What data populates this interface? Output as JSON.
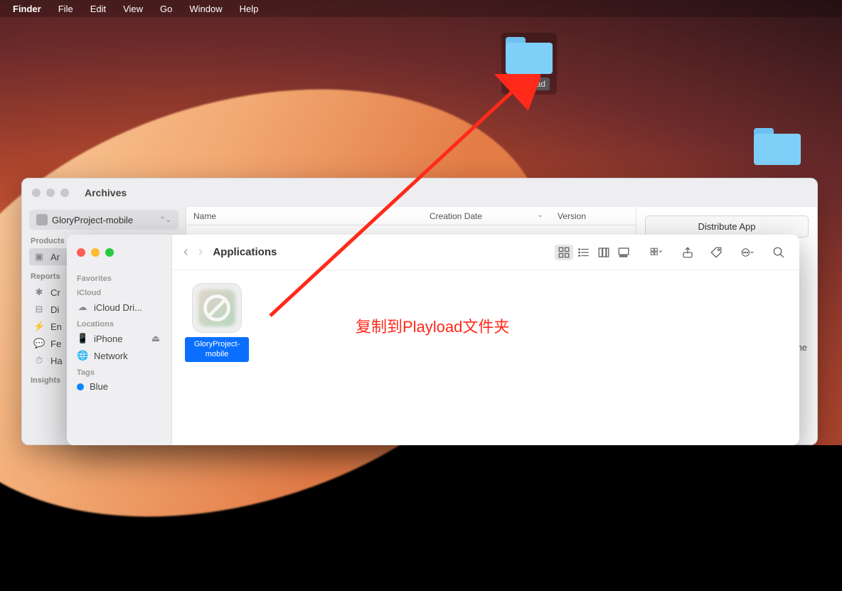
{
  "menubar": {
    "app": "Finder",
    "items": [
      "File",
      "Edit",
      "View",
      "Go",
      "Window",
      "Help"
    ]
  },
  "desktop_icons": {
    "playload": "Playload"
  },
  "xcode": {
    "title": "Archives",
    "project": "GloryProject-mobile",
    "side_groups": {
      "products": {
        "label": "Products",
        "items": [
          "Ar"
        ]
      },
      "reports": {
        "label": "Reports",
        "items": [
          "Cr",
          "Di",
          "En",
          "Fe",
          "Ha"
        ]
      },
      "insights": {
        "label": "Insights"
      }
    },
    "columns": {
      "name": "Name",
      "date": "Creation Date",
      "version": "Version"
    },
    "right": {
      "distribute": "Distribute App",
      "truncated_label": "me"
    }
  },
  "finder": {
    "side": {
      "favorites": "Favorites",
      "icloud": "iCloud",
      "icloud_drive": "iCloud Dri...",
      "locations": "Locations",
      "iphone": "iPhone",
      "network": "Network",
      "tags": "Tags",
      "blue": "Blue"
    },
    "location": "Applications",
    "item": {
      "name": "GloryProject-mobile"
    }
  },
  "annotation": {
    "text": "复制到Playload文件夹"
  }
}
